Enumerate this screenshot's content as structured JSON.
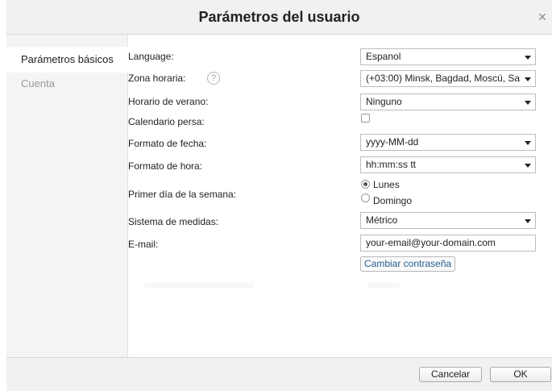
{
  "dialog": {
    "title": "Parámetros del usuario",
    "close_glyph": "×"
  },
  "sidebar": {
    "tabs": [
      {
        "label": "Parámetros básicos",
        "active": true
      },
      {
        "label": "Cuenta",
        "active": false
      }
    ]
  },
  "form": {
    "language": {
      "label": "Language:",
      "value": "Espanol"
    },
    "timezone": {
      "label": "Zona horaria:",
      "help_glyph": "?",
      "value": "(+03:00) Minsk, Bagdad, Moscú, Sa"
    },
    "dst": {
      "label": "Horario de verano:",
      "value": "Ninguno"
    },
    "persian_calendar": {
      "label": "Calendario persa:",
      "checked": false
    },
    "date_format": {
      "label": "Formato de fecha:",
      "value": "yyyy-MM-dd"
    },
    "time_format": {
      "label": "Formato de hora:",
      "value": "hh:mm:ss tt"
    },
    "first_day": {
      "label": "Primer día de la semana:",
      "options": [
        {
          "label": "Lunes",
          "selected": true
        },
        {
          "label": "Domingo",
          "selected": false
        }
      ]
    },
    "units": {
      "label": "Sistema de medidas:",
      "value": "Métrico"
    },
    "email": {
      "label": "E-mail:",
      "value": "your-email@your-domain.com"
    },
    "change_password_label": "Cambiar contraseña"
  },
  "footer": {
    "cancel_label": "Cancelar",
    "ok_label": "OK"
  },
  "icons": {
    "close": "close-icon",
    "help": "help-icon",
    "dropdown": "chevron-down-icon"
  }
}
